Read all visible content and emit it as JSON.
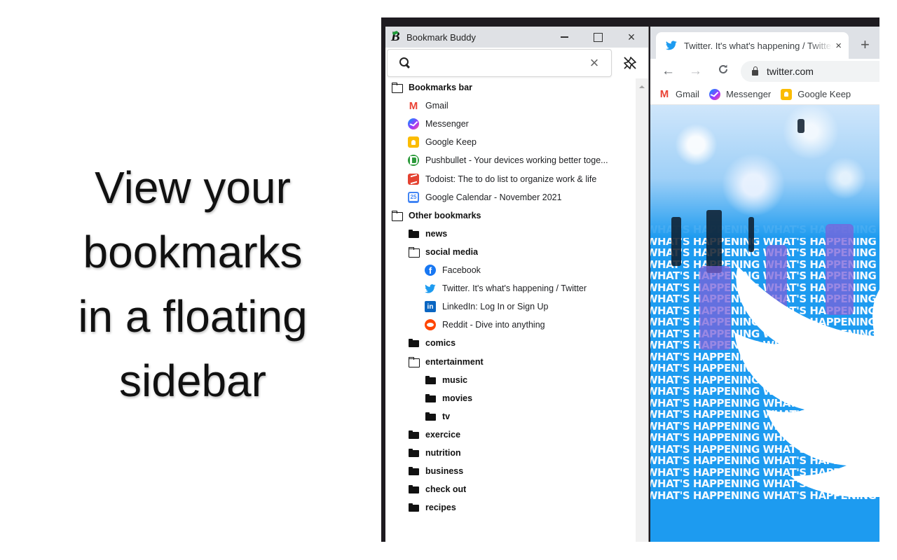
{
  "headline": {
    "lines": [
      "View your",
      "bookmarks",
      "in a floating",
      "sidebar"
    ]
  },
  "sidebar_window": {
    "title": "Bookmark Buddy",
    "logo": "B",
    "controls": {
      "minimize": "minimize-icon",
      "maximize": "maximize-icon",
      "close": "×"
    },
    "search": {
      "value": "",
      "placeholder": "",
      "clear": "×"
    },
    "pin_icon": "unpin-icon",
    "tree": [
      {
        "type": "folder",
        "state": "open",
        "depth": 0,
        "label": "Bookmarks bar"
      },
      {
        "type": "link",
        "depth": 1,
        "label": "Gmail",
        "icon": "gmail"
      },
      {
        "type": "link",
        "depth": 1,
        "label": "Messenger",
        "icon": "messenger"
      },
      {
        "type": "link",
        "depth": 1,
        "label": "Google Keep",
        "icon": "keep"
      },
      {
        "type": "link",
        "depth": 1,
        "label": "Pushbullet - Your devices working better toge...",
        "icon": "pushbullet"
      },
      {
        "type": "link",
        "depth": 1,
        "label": "Todoist: The to do list to organize work & life",
        "icon": "todoist"
      },
      {
        "type": "link",
        "depth": 1,
        "label": "Google Calendar - November 2021",
        "icon": "gcal"
      },
      {
        "type": "folder",
        "state": "open",
        "depth": 0,
        "label": "Other bookmarks"
      },
      {
        "type": "folder",
        "state": "closed",
        "depth": 1,
        "label": "news"
      },
      {
        "type": "folder",
        "state": "open",
        "depth": 1,
        "label": "social media"
      },
      {
        "type": "link",
        "depth": 2,
        "label": "Facebook",
        "icon": "facebook"
      },
      {
        "type": "link",
        "depth": 2,
        "label": "Twitter. It's what's happening / Twitter",
        "icon": "twitter"
      },
      {
        "type": "link",
        "depth": 2,
        "label": "LinkedIn: Log In or Sign Up",
        "icon": "linkedin"
      },
      {
        "type": "link",
        "depth": 2,
        "label": "Reddit - Dive into anything",
        "icon": "reddit"
      },
      {
        "type": "folder",
        "state": "closed",
        "depth": 1,
        "label": "comics"
      },
      {
        "type": "folder",
        "state": "open",
        "depth": 1,
        "label": "entertainment"
      },
      {
        "type": "folder",
        "state": "closed",
        "depth": 2,
        "label": "music"
      },
      {
        "type": "folder",
        "state": "closed",
        "depth": 2,
        "label": "movies"
      },
      {
        "type": "folder",
        "state": "closed",
        "depth": 2,
        "label": "tv"
      },
      {
        "type": "folder",
        "state": "closed",
        "depth": 1,
        "label": "exercice"
      },
      {
        "type": "folder",
        "state": "closed",
        "depth": 1,
        "label": "nutrition"
      },
      {
        "type": "folder",
        "state": "closed",
        "depth": 1,
        "label": "business"
      },
      {
        "type": "folder",
        "state": "closed",
        "depth": 1,
        "label": "check out"
      },
      {
        "type": "folder",
        "state": "closed",
        "depth": 1,
        "label": "recipes"
      }
    ]
  },
  "browser": {
    "tab": {
      "title": "Twitter. It's what's happening / Twitter",
      "close": "×"
    },
    "new_tab": "+",
    "nav": {
      "back": "←",
      "forward": "→",
      "reload": "C"
    },
    "url": "twitter.com",
    "bookmarks_bar": [
      {
        "label": "Gmail",
        "icon": "gmail"
      },
      {
        "label": "Messenger",
        "icon": "messenger"
      },
      {
        "label": "Google Keep",
        "icon": "keep"
      }
    ],
    "page_text": "WHAT'S HAPPENING"
  },
  "colors": {
    "twitter_blue": "#1d9bf0",
    "titlebar": "#dfe1e5",
    "accent_purple": "#7b61d9"
  }
}
